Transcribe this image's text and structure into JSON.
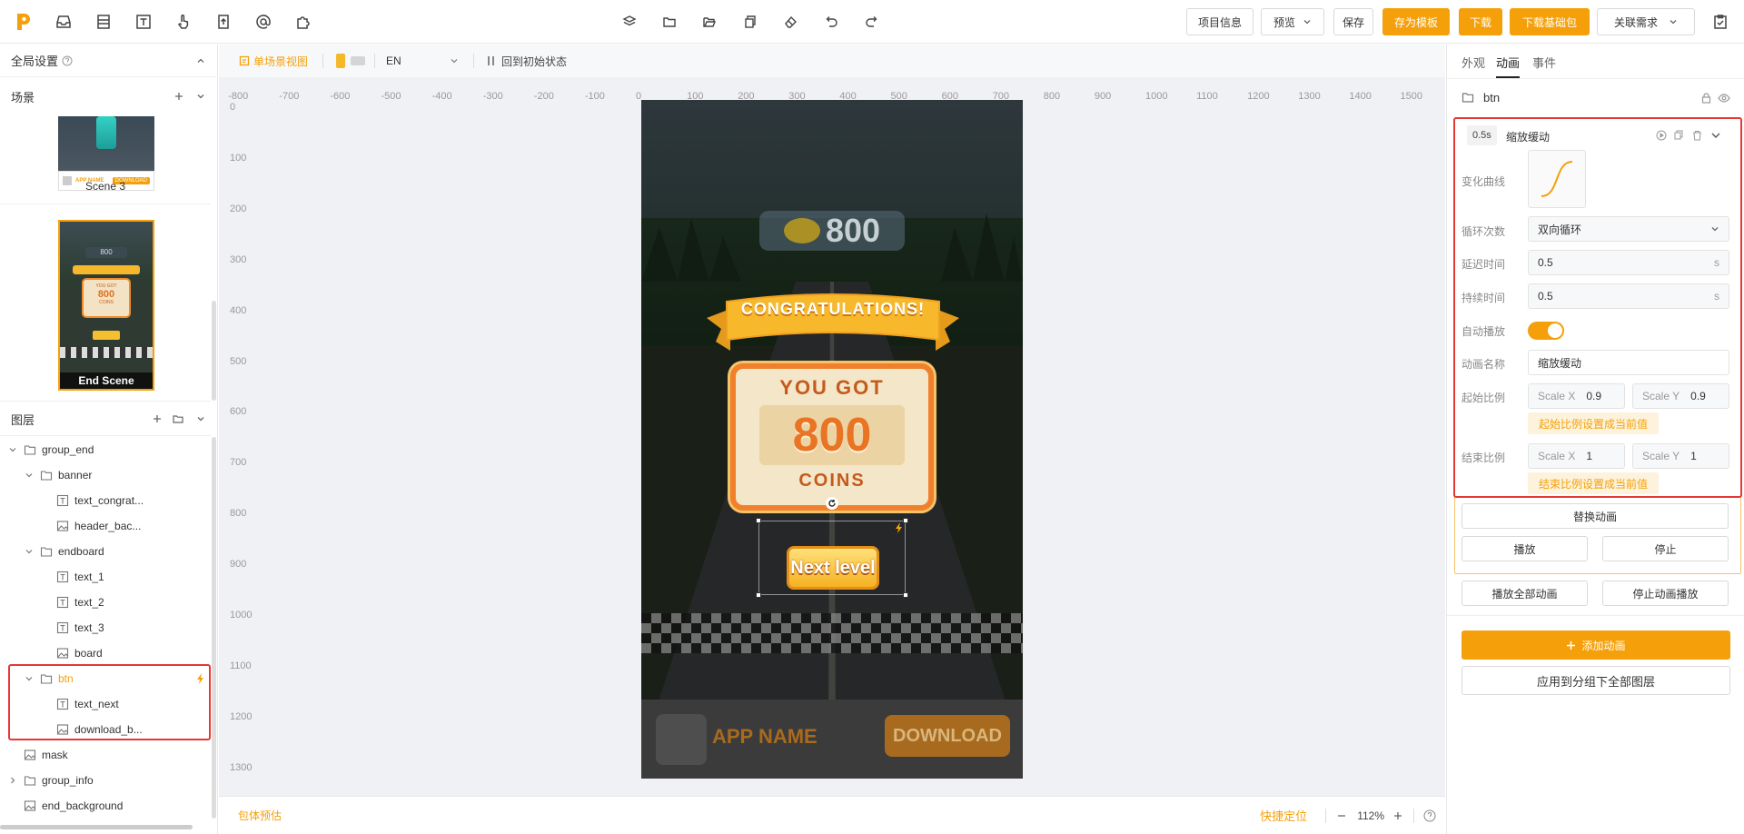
{
  "toolbar": {
    "project_info": "项目信息",
    "preview": "预览",
    "save": "保存",
    "save_template": "存为模板",
    "download": "下载",
    "download_base": "下载基础包",
    "link_demand": "关联需求"
  },
  "left": {
    "global_settings": "全局设置",
    "scenes_title": "场景",
    "scene3_label": "Scene 3",
    "end_scene_label": "End Scene",
    "thumb_app_name": "APP NAME",
    "thumb_download": "DOWNLOAD",
    "thumb_coins": "800",
    "thumb_you_got": "YOU GOT",
    "thumb_coins_word": "COINS",
    "layers_title": "图层",
    "layers": [
      {
        "name": "group_end",
        "type": "folder",
        "depth": 0,
        "open": true
      },
      {
        "name": "banner",
        "type": "folder",
        "depth": 1,
        "open": true
      },
      {
        "name": "text_congrat...",
        "type": "text",
        "depth": 2
      },
      {
        "name": "header_bac...",
        "type": "image",
        "depth": 2
      },
      {
        "name": "endboard",
        "type": "folder",
        "depth": 1,
        "open": true
      },
      {
        "name": "text_1",
        "type": "text",
        "depth": 2
      },
      {
        "name": "text_2",
        "type": "text",
        "depth": 2
      },
      {
        "name": "text_3",
        "type": "text",
        "depth": 2
      },
      {
        "name": "board",
        "type": "image",
        "depth": 2
      },
      {
        "name": "btn",
        "type": "folder",
        "depth": 1,
        "open": true,
        "selected": true
      },
      {
        "name": "text_next",
        "type": "text",
        "depth": 2
      },
      {
        "name": "download_b...",
        "type": "image",
        "depth": 2
      },
      {
        "name": "mask",
        "type": "image",
        "depth": 0
      },
      {
        "name": "group_info",
        "type": "folder",
        "depth": 0,
        "open": false
      },
      {
        "name": "end_background",
        "type": "image",
        "depth": 0
      }
    ]
  },
  "canvas": {
    "single_scene_view": "单场景视图",
    "language": "EN",
    "reset_state": "回到初始状态",
    "ruler_x": [
      "-800",
      "-700",
      "-600",
      "-500",
      "-400",
      "-300",
      "-200",
      "-100",
      "0",
      "100",
      "200",
      "300",
      "400",
      "500",
      "600",
      "700",
      "800",
      "900",
      "1000",
      "1100",
      "1200",
      "1300",
      "1400",
      "1500"
    ],
    "ruler_y": [
      "0",
      "100",
      "200",
      "300",
      "400",
      "500",
      "600",
      "700",
      "800",
      "900",
      "1000",
      "1100",
      "1200",
      "1300"
    ],
    "bottom_left": "包体预估",
    "quick_locate": "快捷定位",
    "zoom": "112%"
  },
  "game": {
    "coins_top": "800",
    "congrats": "CONGRATULATIONS!",
    "you_got": "YOU GOT",
    "coins_value": "800",
    "coins_word": "COINS",
    "next_level": "Next level",
    "app_name": "APP NAME",
    "download": "DOWNLOAD"
  },
  "right": {
    "tabs": [
      "外观",
      "动画",
      "事件"
    ],
    "active_tab": "动画",
    "layer_name": "btn",
    "anim_duration_tag": "0.5s",
    "anim_title": "缩放缓动",
    "curve_label": "变化曲线",
    "loop_label": "循环次数",
    "loop_value": "双向循环",
    "delay_label": "延迟时间",
    "delay_value": "0.5",
    "duration_label": "持续时间",
    "duration_value": "0.5",
    "unit_s": "s",
    "autoplay_label": "自动播放",
    "name_label": "动画名称",
    "name_value": "缩放缓动",
    "start_scale_label": "起始比例",
    "scale_x_label": "Scale X",
    "scale_y_label": "Scale Y",
    "start_x": "0.9",
    "start_y": "0.9",
    "set_start_current": "起始比例设置成当前值",
    "end_scale_label": "结束比例",
    "end_x": "1",
    "end_y": "1",
    "set_end_current": "结束比例设置成当前值",
    "replace_anim": "替换动画",
    "play": "播放",
    "stop": "停止",
    "play_all": "播放全部动画",
    "stop_all": "停止动画播放",
    "add_anim": "添加动画",
    "apply_group": "应用到分组下全部图层"
  },
  "colors": {
    "accent": "#f5a00a",
    "highlight": "#e53935"
  }
}
